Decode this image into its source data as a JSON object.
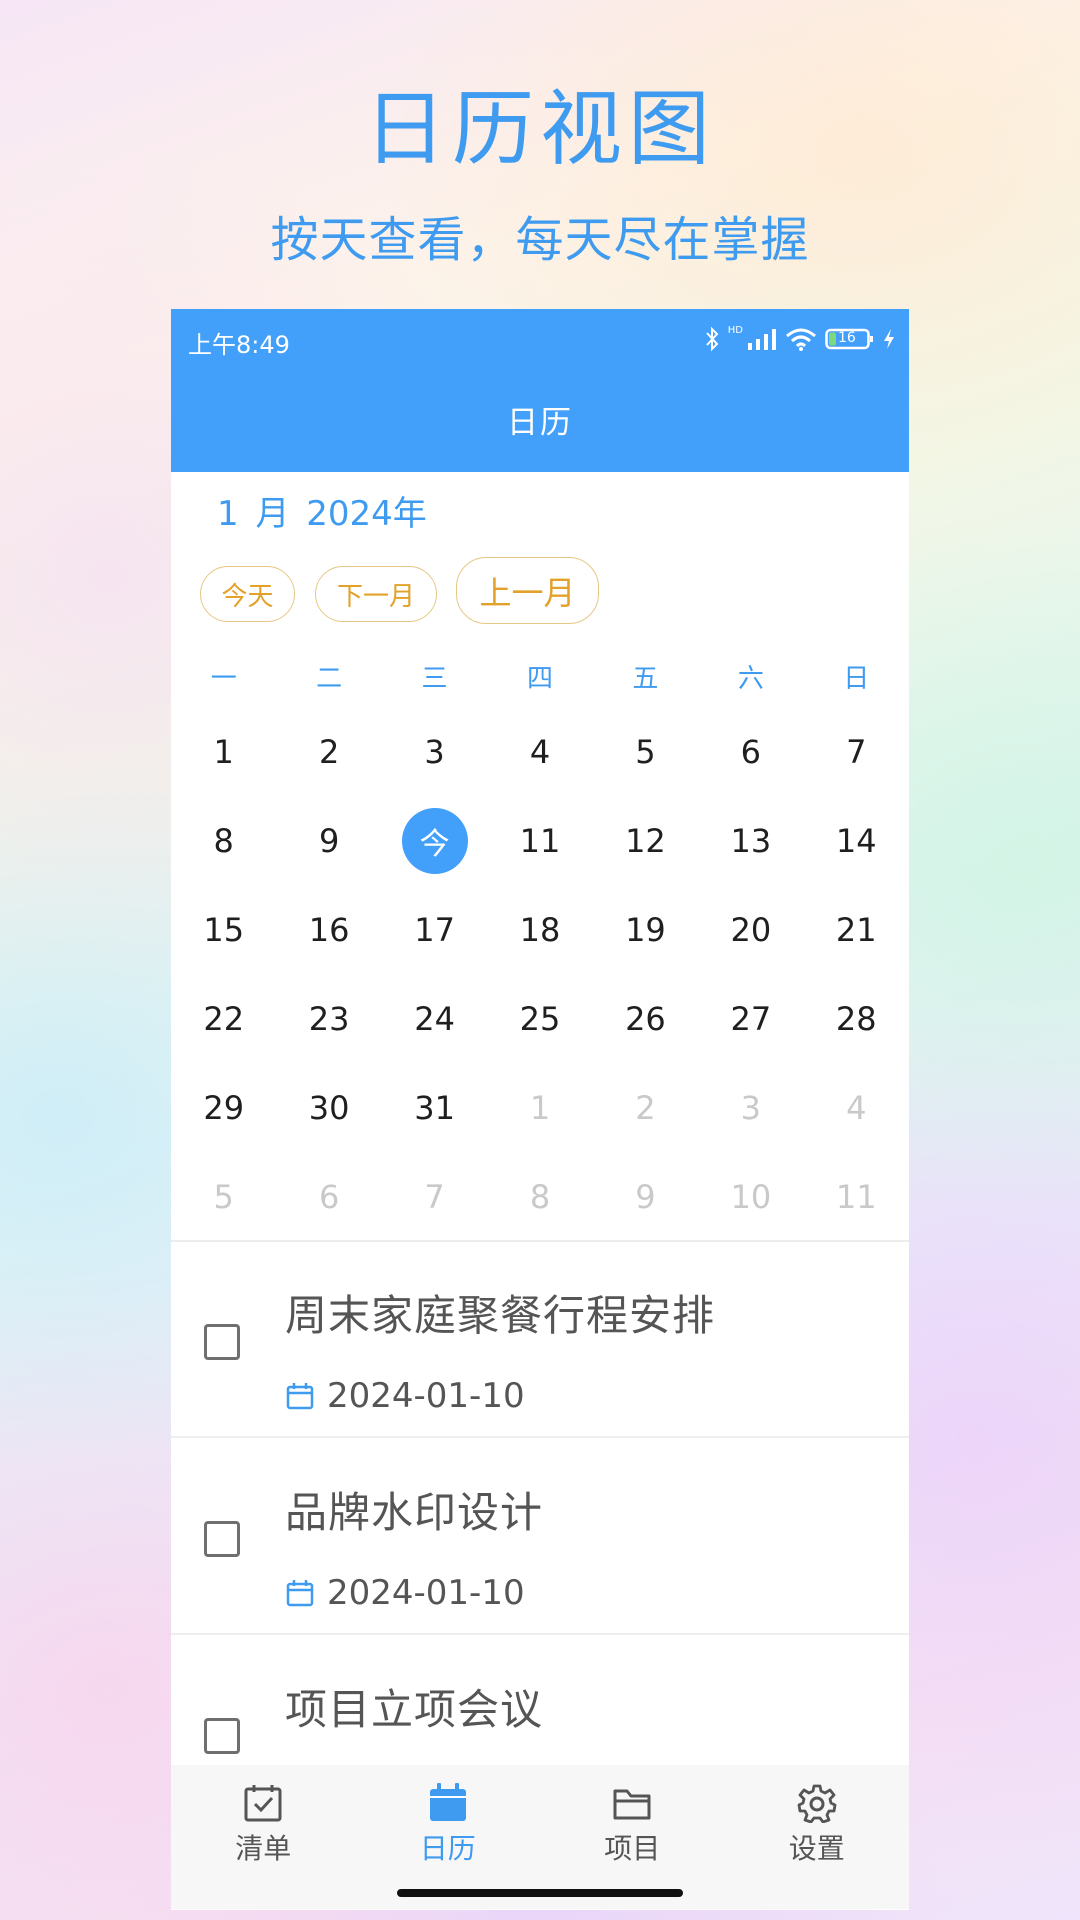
{
  "promo": {
    "headline": "日历视图",
    "subline": "按天查看，每天尽在掌握"
  },
  "status_bar": {
    "time": "上午8:49",
    "network_label": "HD",
    "battery_level": "16"
  },
  "header": {
    "title": "日历"
  },
  "calendar": {
    "month_label": "1 月  2024年",
    "buttons": {
      "today": "今天",
      "next_month": "下一月",
      "prev_month": "上一月"
    },
    "weekdays": [
      "一",
      "二",
      "三",
      "四",
      "五",
      "六",
      "日"
    ],
    "today_label": "今",
    "days": [
      {
        "label": "1",
        "dim": false
      },
      {
        "label": "2",
        "dim": false
      },
      {
        "label": "3",
        "dim": false
      },
      {
        "label": "4",
        "dim": false
      },
      {
        "label": "5",
        "dim": false
      },
      {
        "label": "6",
        "dim": false
      },
      {
        "label": "7",
        "dim": false
      },
      {
        "label": "8",
        "dim": false
      },
      {
        "label": "9",
        "dim": false
      },
      {
        "label": "今",
        "dim": false,
        "today": true
      },
      {
        "label": "11",
        "dim": false
      },
      {
        "label": "12",
        "dim": false
      },
      {
        "label": "13",
        "dim": false
      },
      {
        "label": "14",
        "dim": false
      },
      {
        "label": "15",
        "dim": false
      },
      {
        "label": "16",
        "dim": false
      },
      {
        "label": "17",
        "dim": false
      },
      {
        "label": "18",
        "dim": false
      },
      {
        "label": "19",
        "dim": false
      },
      {
        "label": "20",
        "dim": false
      },
      {
        "label": "21",
        "dim": false
      },
      {
        "label": "22",
        "dim": false
      },
      {
        "label": "23",
        "dim": false
      },
      {
        "label": "24",
        "dim": false
      },
      {
        "label": "25",
        "dim": false
      },
      {
        "label": "26",
        "dim": false
      },
      {
        "label": "27",
        "dim": false
      },
      {
        "label": "28",
        "dim": false
      },
      {
        "label": "29",
        "dim": false
      },
      {
        "label": "30",
        "dim": false
      },
      {
        "label": "31",
        "dim": false
      },
      {
        "label": "1",
        "dim": true
      },
      {
        "label": "2",
        "dim": true
      },
      {
        "label": "3",
        "dim": true
      },
      {
        "label": "4",
        "dim": true
      },
      {
        "label": "5",
        "dim": true
      },
      {
        "label": "6",
        "dim": true
      },
      {
        "label": "7",
        "dim": true
      },
      {
        "label": "8",
        "dim": true
      },
      {
        "label": "9",
        "dim": true
      },
      {
        "label": "10",
        "dim": true
      },
      {
        "label": "11",
        "dim": true
      }
    ]
  },
  "tasks": [
    {
      "title": "周末家庭聚餐行程安排",
      "date": "2024-01-10",
      "checked": false
    },
    {
      "title": "品牌水印设计",
      "date": "2024-01-10",
      "checked": false
    },
    {
      "title": "项目立项会议",
      "date": "",
      "checked": false
    }
  ],
  "tabbar": {
    "items": [
      {
        "label": "清单",
        "icon": "checklist-icon",
        "active": false
      },
      {
        "label": "日历",
        "icon": "calendar-icon",
        "active": true
      },
      {
        "label": "项目",
        "icon": "folder-icon",
        "active": false
      },
      {
        "label": "设置",
        "icon": "gear-icon",
        "active": false
      }
    ]
  },
  "colors": {
    "accent": "#429ffa",
    "headline_blue": "#3f9bef",
    "button_gold": "#e3a12a",
    "dim_day": "#c9c9c9"
  }
}
